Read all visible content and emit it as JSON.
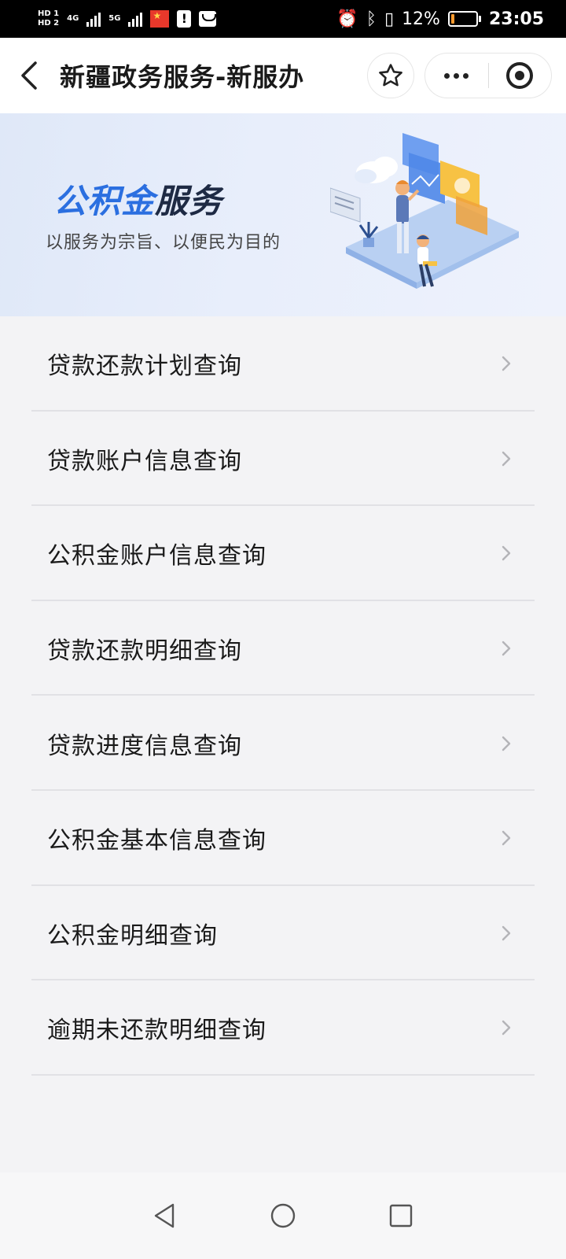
{
  "status_bar": {
    "sim1": "HD 1",
    "sim2": "HD 2",
    "net1": "4G",
    "net2": "5G",
    "battery_percent": "12%",
    "battery_level": 0.12,
    "time": "23:05",
    "icons": [
      "alarm-icon",
      "bluetooth-icon",
      "vibrate-icon",
      "battery-icon"
    ]
  },
  "nav": {
    "title": "新疆政务服务-新服办"
  },
  "banner": {
    "title_blue": "公积金",
    "title_dark": "服务",
    "subtitle": "以服务为宗旨、以便民为目的"
  },
  "menu": {
    "items": [
      {
        "label": "贷款还款计划查询"
      },
      {
        "label": "贷款账户信息查询"
      },
      {
        "label": "公积金账户信息查询"
      },
      {
        "label": "贷款还款明细查询"
      },
      {
        "label": "贷款进度信息查询"
      },
      {
        "label": "公积金基本信息查询"
      },
      {
        "label": "公积金明细查询"
      },
      {
        "label": "逾期未还款明细查询"
      }
    ]
  },
  "colors": {
    "accent_blue": "#2b6fe0",
    "title_dark": "#1e2a44",
    "page_bg": "#f3f3f5"
  }
}
